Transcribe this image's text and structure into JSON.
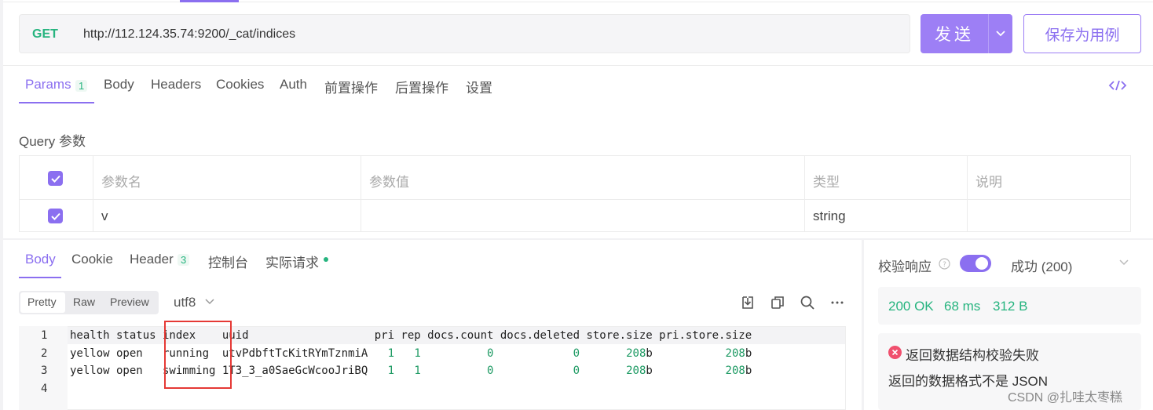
{
  "request": {
    "method": "GET",
    "url": "http://112.124.35.74:9200/_cat/indices",
    "send_label": "发送",
    "save_label": "保存为用例"
  },
  "req_tabs": {
    "params": "Params",
    "params_count": "1",
    "body": "Body",
    "headers": "Headers",
    "cookies": "Cookies",
    "auth": "Auth",
    "pre": "前置操作",
    "post": "后置操作",
    "settings": "设置"
  },
  "query": {
    "label": "Query 参数",
    "headers": {
      "name": "参数名",
      "value": "参数值",
      "type": "类型",
      "desc": "说明"
    },
    "rows": [
      {
        "name": "v",
        "value": "",
        "type": "string",
        "desc": ""
      }
    ]
  },
  "resp_tabs": {
    "body": "Body",
    "cookie": "Cookie",
    "header": "Header",
    "header_count": "3",
    "console": "控制台",
    "actual": "实际请求"
  },
  "format": {
    "pretty": "Pretty",
    "raw": "Raw",
    "preview": "Preview",
    "encoding": "utf8"
  },
  "code_lines": [
    {
      "n": "1",
      "text": "health status index    uuid                   pri rep docs.count docs.deleted store.size pri.store.size"
    },
    {
      "n": "2",
      "text": "yellow open   running  utvPdbftTcKitRYmTznmiA   1   1          0            0       208b           208b"
    },
    {
      "n": "3",
      "text": "yellow open   swimming 1T3_3_a0SaeGcWcooJriBQ   1   1          0            0       208b           208b"
    },
    {
      "n": "4",
      "text": ""
    }
  ],
  "verify": {
    "label": "校验响应",
    "result": "成功 (200)",
    "status": "200 OK",
    "time": "68 ms",
    "size": "312 B",
    "error_title": "返回数据结构校验失败",
    "error_desc": "返回的数据格式不是 JSON"
  },
  "watermark": "CSDN @扎哇太枣糕",
  "colors": {
    "accent": "#8b6ff0",
    "green": "#26b47f",
    "error": "#f0506e"
  }
}
